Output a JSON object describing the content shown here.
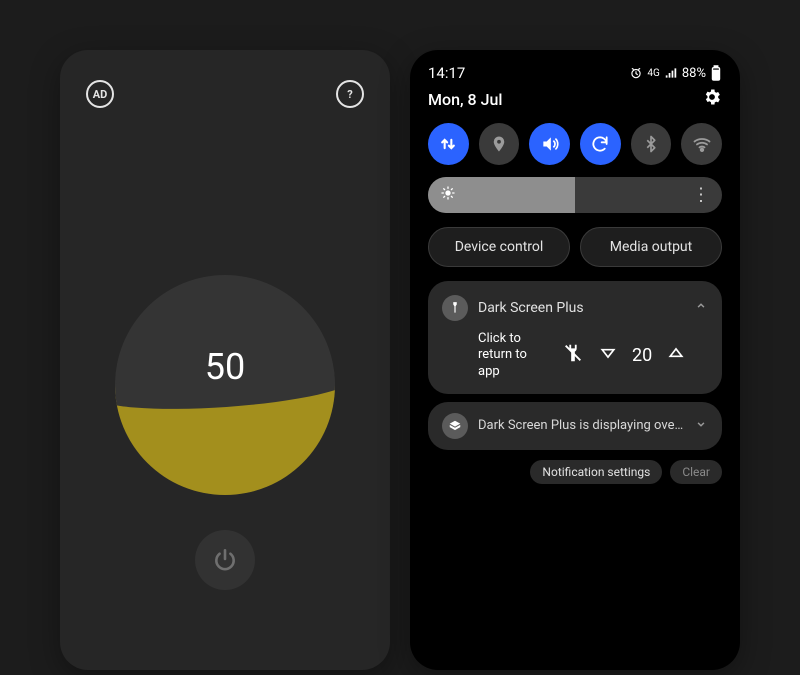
{
  "app": {
    "ad_label": "AD",
    "help_label": "?",
    "dial_value": "50"
  },
  "shade": {
    "time": "14:17",
    "signal_label": "4G",
    "battery_pct": "88%",
    "date": "Mon, 8 Jul",
    "device_control_label": "Device control",
    "media_output_label": "Media output",
    "notif": {
      "title": "Dark Screen Plus",
      "body": "Click to return to app",
      "value": "20"
    },
    "notif2_text": "Dark Screen Plus is displaying over othe...",
    "notif_settings_label": "Notification settings",
    "clear_label": "Clear"
  }
}
